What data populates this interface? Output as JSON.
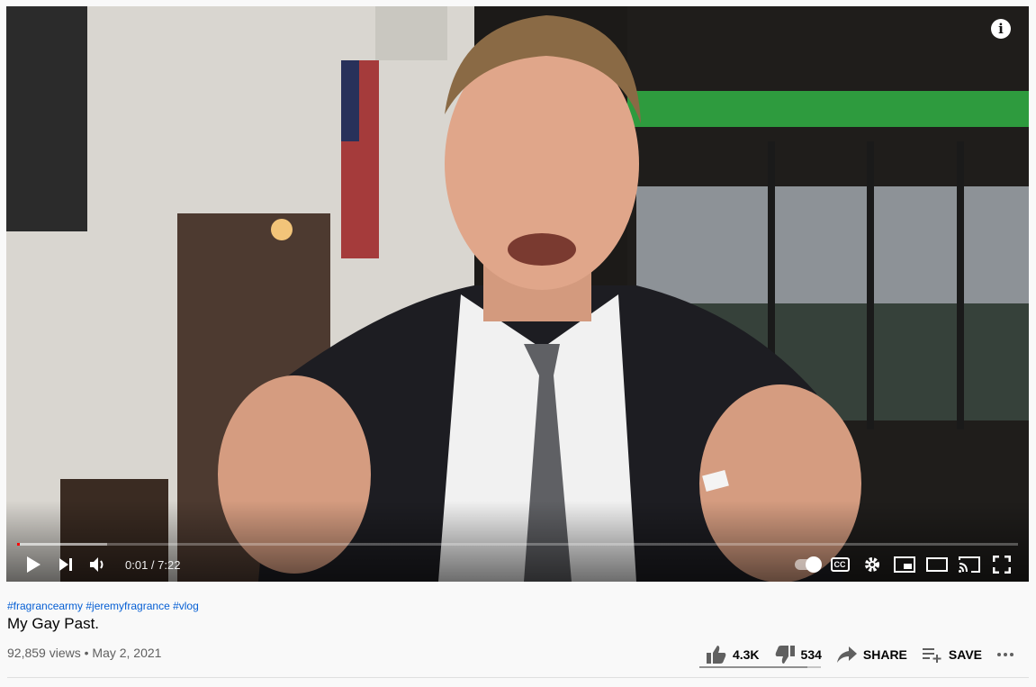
{
  "player": {
    "progress_fraction": 0.0023,
    "buffered_fraction": 0.09,
    "current_time": "0:01",
    "duration": "7:22",
    "time_separator": " / ",
    "accent": "#ff0000"
  },
  "video": {
    "hashtags": "#fragrancearmy #jeremyfragrance #vlog",
    "title": "My Gay Past.",
    "views": "92,859 views",
    "separator": " • ",
    "date": "May 2, 2021"
  },
  "actions": {
    "like_count": "4.3K",
    "dislike_count": "534",
    "share_label": "SHARE",
    "save_label": "SAVE",
    "like_ratio": 0.89
  },
  "icons": {
    "info": "info-icon",
    "play": "play-icon",
    "next": "next-icon",
    "volume": "volume-icon",
    "autoplay": "autoplay-toggle-icon",
    "captions": "captions-icon",
    "settings": "gear-icon",
    "miniplayer": "miniplayer-icon",
    "theater": "theater-mode-icon",
    "cast": "cast-icon",
    "fullscreen": "fullscreen-icon",
    "like": "thumbs-up-icon",
    "dislike": "thumbs-down-icon",
    "share": "share-arrow-icon",
    "save": "playlist-add-icon",
    "more": "more-dots-icon"
  }
}
